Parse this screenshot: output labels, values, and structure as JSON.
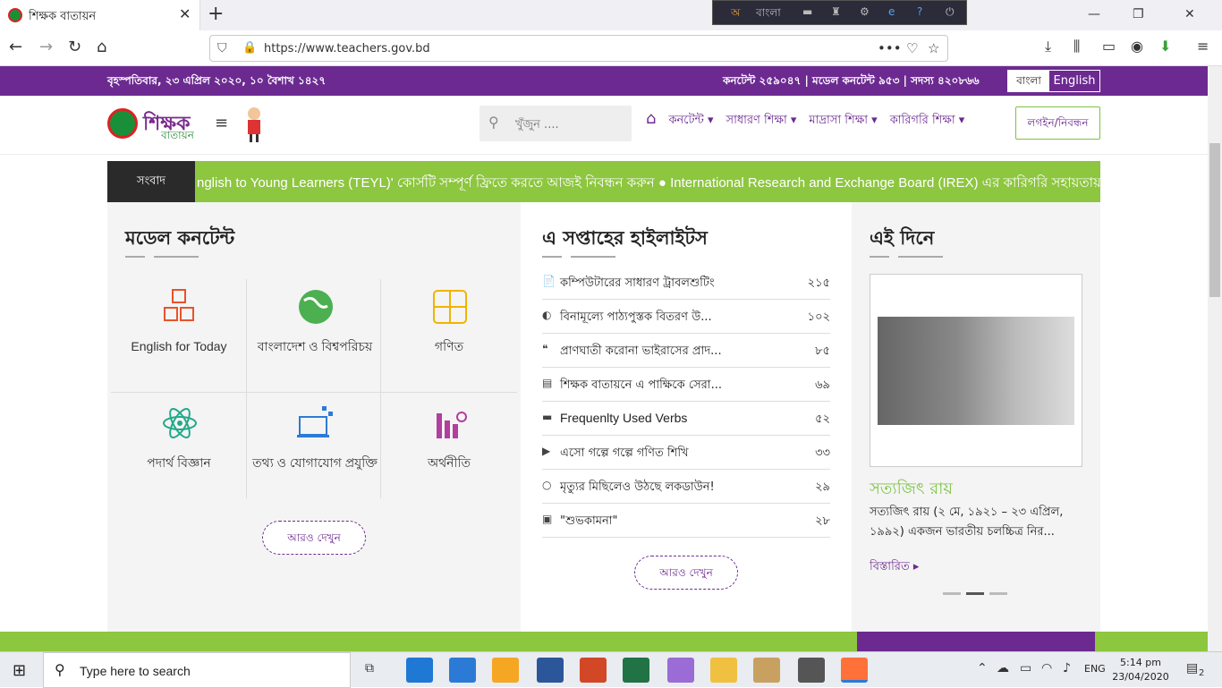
{
  "browser": {
    "tab_title": "শিক্ষক বাতায়ন",
    "url": "https://www.teachers.gov.bd",
    "tray_label": "বাংলা"
  },
  "site": {
    "date_line": "বৃহস্পতিবার, ২৩ এপ্রিল ২০২০, ১০ বৈশাখ ১৪২৭",
    "stats_line": "কনটেন্ট ২৫৯০৪৭ | মডেল কনটেন্ট ৯৫৩ | সদস্য ৪২০৮৬৬",
    "lang_bn": "বাংলা",
    "lang_en": "English",
    "logo_text": "শিক্ষক",
    "logo_sub": "বাতায়ন",
    "search_placeholder": "খুঁজুন ....",
    "menu": [
      "কনটেন্ট ▾",
      "সাধারণ শিক্ষা ▾",
      "মাদ্রাসা শিক্ষা ▾",
      "কারিগরি শিক্ষা ▾"
    ],
    "login": "লগইন/নিবন্ধন",
    "ticker_label": "সংবাদ",
    "ticker_text": "nglish to Young Learners (TEYL)' কোর্সটি সম্পূর্ণ ফ্রিতে করতে আজই নিবন্ধন করুন  ●  International Research and Exchange Board (IREX) এর কারিগরি সহায়তায়"
  },
  "model_content": {
    "title": "মডেল কনটেন্ট",
    "items": [
      {
        "label": "English for Today",
        "icon": "abc-blocks-icon"
      },
      {
        "label": "বাংলাদেশ ও বিশ্বপরিচয়",
        "icon": "globe-icon"
      },
      {
        "label": "গণিত",
        "icon": "calculator-icon"
      },
      {
        "label": "পদার্থ বিজ্ঞান",
        "icon": "atom-icon"
      },
      {
        "label": "তথ্য ও যোগাযোগ প্রযুক্তি",
        "icon": "computer-icon"
      },
      {
        "label": "অর্থনীতি",
        "icon": "bar-chart-icon"
      }
    ],
    "more": "আরও দেখুন"
  },
  "highlights": {
    "title": "এ সপ্তাহের হাইলাইটস",
    "items": [
      {
        "icon": "📄",
        "title": "কম্পিউটারের সাধারণ ট্রাবলশুটিং",
        "count": "২১৫"
      },
      {
        "icon": "◐",
        "title": "বিনামূল্যে পাঠ্যপুস্তক বিতরণ উ...",
        "count": "১০২"
      },
      {
        "icon": "❝",
        "title": "প্রাণঘাতী করোনা ভাইরাসের প্রাদ...",
        "count": "৮৫"
      },
      {
        "icon": "▤",
        "title": "শিক্ষক বাতায়নে এ পাক্ষিকে সেরা...",
        "count": "৬৯"
      },
      {
        "icon": "▬",
        "title": "Frequenlty Used Verbs",
        "count": "৫২"
      },
      {
        "icon": "▶",
        "title": "এসো গল্পে গল্পে গণিত শিখি",
        "count": "৩৩"
      },
      {
        "icon": "○",
        "title": "মৃত্যুর মিছিলেও উঠছে লকডাউন!",
        "count": "২৯"
      },
      {
        "icon": "▣",
        "title": "\"শুভকামনা\"",
        "count": "২৮"
      }
    ],
    "more": "আরও দেখুন"
  },
  "this_day": {
    "title": "এই দিনে",
    "name": "সত্যজিৎ রায়",
    "desc": "সত্যজিৎ রায় (২ মে, ১৯২১ – ২৩ এপ্রিল, ১৯৯২) একজন ভারতীয় চলচ্চিত্র নির...",
    "more": "বিস্তারিত ▸"
  },
  "taskbar": {
    "search_placeholder": "Type here to search",
    "lang": "ENG",
    "time": "5:14 pm",
    "date": "23/04/2020",
    "notif_count": "2"
  },
  "colors": {
    "purple": "#6c2a91",
    "green": "#8dc63f"
  }
}
